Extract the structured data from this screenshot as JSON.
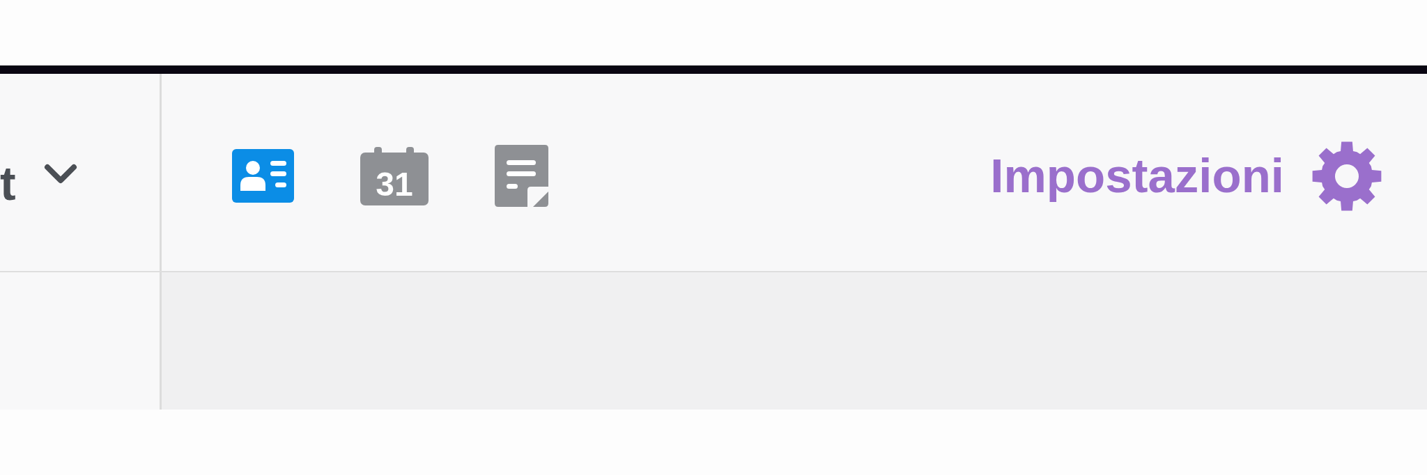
{
  "toolbar": {
    "dropdown": {
      "label": "t"
    },
    "apps": [
      {
        "kind": "contacts",
        "selected": true
      },
      {
        "kind": "calendar",
        "day": "31",
        "selected": false
      },
      {
        "kind": "notes",
        "selected": false
      }
    ],
    "settings": {
      "label": "Impostazioni"
    }
  }
}
